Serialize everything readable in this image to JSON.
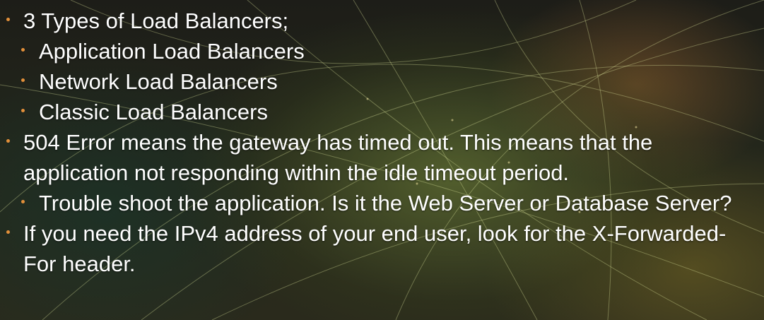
{
  "slide": {
    "bullets": [
      {
        "level": 1,
        "text": "3 Types of Load Balancers;"
      },
      {
        "level": 2,
        "text": "Application Load Balancers"
      },
      {
        "level": 2,
        "text": "Network Load Balancers"
      },
      {
        "level": 2,
        "text": "Classic Load Balancers"
      },
      {
        "level": 1,
        "text": "504 Error means the gateway has timed out. This means that the application not responding within the idle timeout period."
      },
      {
        "level": 2,
        "text": "Trouble shoot the application. Is it the Web Server or Database Server?"
      },
      {
        "level": 1,
        "text": "If you need the IPv4 address of your end user, look for the X-Forwarded-For header."
      }
    ]
  },
  "colors": {
    "bullet_dot": "#e3903a",
    "text": "#ffffff"
  }
}
